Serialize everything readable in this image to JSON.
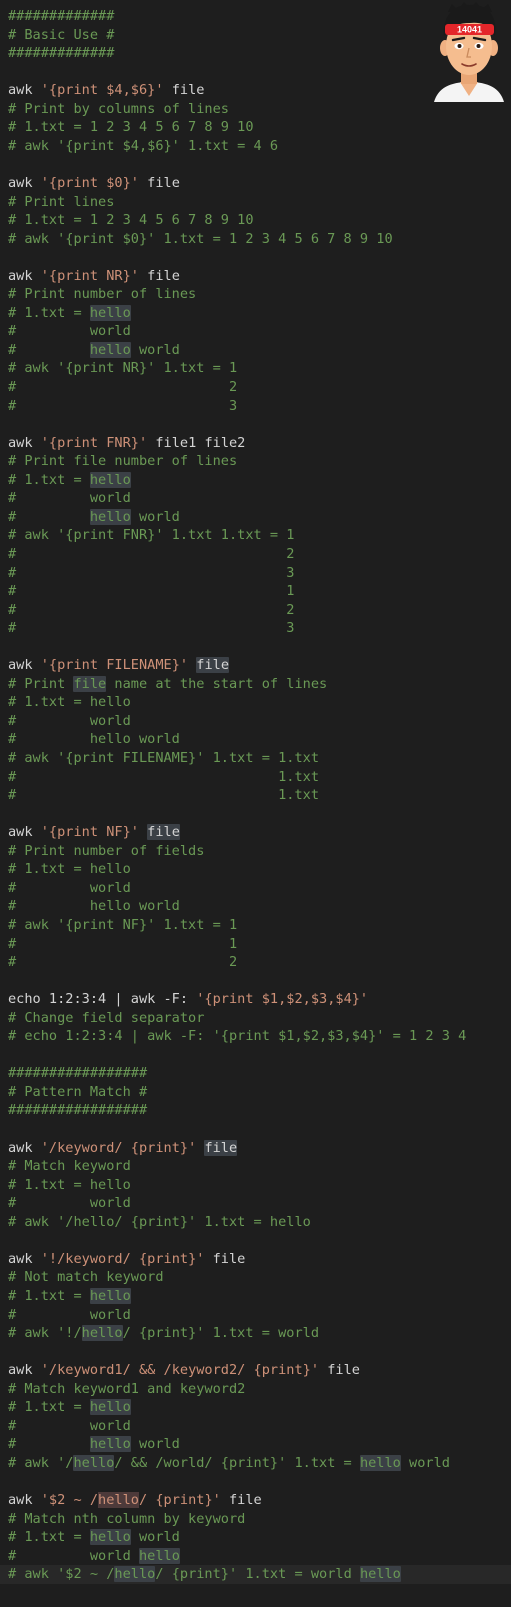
{
  "lines": [
    [
      [
        "#############",
        "cm"
      ]
    ],
    [
      [
        "# Basic Use #",
        "cm"
      ]
    ],
    [
      [
        "#############",
        "cm"
      ]
    ],
    [],
    [
      [
        "awk ",
        "pl"
      ],
      [
        "'{print $4,$6}'",
        "st"
      ],
      [
        " file",
        "pl"
      ]
    ],
    [
      [
        "# Print by columns of lines",
        "cm"
      ]
    ],
    [
      [
        "# 1.txt = 1 2 3 4 5 6 7 8 9 10",
        "cm"
      ]
    ],
    [
      [
        "# awk '{print $4,$6}' 1.txt = 4 6",
        "cm"
      ]
    ],
    [],
    [
      [
        "awk ",
        "pl"
      ],
      [
        "'{print $0}'",
        "st"
      ],
      [
        " file",
        "pl"
      ]
    ],
    [
      [
        "# Print lines",
        "cm"
      ]
    ],
    [
      [
        "# 1.txt = 1 2 3 4 5 6 7 8 9 10",
        "cm"
      ]
    ],
    [
      [
        "# awk '{print $0}' 1.txt = 1 2 3 4 5 6 7 8 9 10",
        "cm"
      ]
    ],
    [],
    [
      [
        "awk ",
        "pl"
      ],
      [
        "'{print NR}'",
        "st"
      ],
      [
        " file",
        "pl"
      ]
    ],
    [
      [
        "# Print number of lines",
        "cm"
      ]
    ],
    [
      [
        "# 1.txt = ",
        "cm"
      ],
      [
        "hello",
        "cm hl"
      ]
    ],
    [
      [
        "#         world",
        "cm"
      ]
    ],
    [
      [
        "#         ",
        "cm"
      ],
      [
        "hello",
        "cm hl"
      ],
      [
        " world",
        "cm"
      ]
    ],
    [
      [
        "# awk '{print NR}' 1.txt = 1",
        "cm"
      ]
    ],
    [
      [
        "#                          2",
        "cm"
      ]
    ],
    [
      [
        "#                          3",
        "cm"
      ]
    ],
    [],
    [
      [
        "awk ",
        "pl"
      ],
      [
        "'{print FNR}'",
        "st"
      ],
      [
        " file1 file2",
        "pl"
      ]
    ],
    [
      [
        "# Print file number of lines",
        "cm"
      ]
    ],
    [
      [
        "# 1.txt = ",
        "cm"
      ],
      [
        "hello",
        "cm hl"
      ]
    ],
    [
      [
        "#         world",
        "cm"
      ]
    ],
    [
      [
        "#         ",
        "cm"
      ],
      [
        "hello",
        "cm hl"
      ],
      [
        " world",
        "cm"
      ]
    ],
    [
      [
        "# awk '{print FNR}' 1.txt 1.txt = 1",
        "cm"
      ]
    ],
    [
      [
        "#                                 2",
        "cm"
      ]
    ],
    [
      [
        "#                                 3",
        "cm"
      ]
    ],
    [
      [
        "#                                 1",
        "cm"
      ]
    ],
    [
      [
        "#                                 2",
        "cm"
      ]
    ],
    [
      [
        "#                                 3",
        "cm"
      ]
    ],
    [],
    [
      [
        "awk ",
        "pl"
      ],
      [
        "'{print FILENAME}'",
        "st"
      ],
      [
        " ",
        "pl"
      ],
      [
        "file",
        "pl hl"
      ]
    ],
    [
      [
        "# Print ",
        "cm"
      ],
      [
        "file",
        "cm hl"
      ],
      [
        " name at the start of lines",
        "cm"
      ]
    ],
    [
      [
        "# 1.txt = hello",
        "cm"
      ]
    ],
    [
      [
        "#         world",
        "cm"
      ]
    ],
    [
      [
        "#         hello world",
        "cm"
      ]
    ],
    [
      [
        "# awk '{print FILENAME}' 1.txt = 1.txt",
        "cm"
      ]
    ],
    [
      [
        "#                                1.txt",
        "cm"
      ]
    ],
    [
      [
        "#                                1.txt",
        "cm"
      ]
    ],
    [],
    [
      [
        "awk ",
        "pl"
      ],
      [
        "'{print NF}'",
        "st"
      ],
      [
        " ",
        "pl"
      ],
      [
        "file",
        "pl hl"
      ]
    ],
    [
      [
        "# Print number of fields",
        "cm"
      ]
    ],
    [
      [
        "# 1.txt = hello",
        "cm"
      ]
    ],
    [
      [
        "#         world",
        "cm"
      ]
    ],
    [
      [
        "#         hello world",
        "cm"
      ]
    ],
    [
      [
        "# awk '{print NF}' 1.txt = 1",
        "cm"
      ]
    ],
    [
      [
        "#                          1",
        "cm"
      ]
    ],
    [
      [
        "#                          2",
        "cm"
      ]
    ],
    [],
    [
      [
        "echo 1:2:3:4 | awk -F: ",
        "pl"
      ],
      [
        "'{print $1,$2,$3,$4}'",
        "st"
      ]
    ],
    [
      [
        "# Change field separator",
        "cm"
      ]
    ],
    [
      [
        "# echo 1:2:3:4 | awk -F: '{print $1,$2,$3,$4}' = 1 2 3 4",
        "cm"
      ]
    ],
    [],
    [
      [
        "#################",
        "cm"
      ]
    ],
    [
      [
        "# Pattern Match #",
        "cm"
      ]
    ],
    [
      [
        "#################",
        "cm"
      ]
    ],
    [],
    [
      [
        "awk ",
        "pl"
      ],
      [
        "'/keyword/ {print}'",
        "st"
      ],
      [
        " ",
        "pl"
      ],
      [
        "file",
        "pl hl"
      ]
    ],
    [
      [
        "# Match keyword",
        "cm"
      ]
    ],
    [
      [
        "# 1.txt = hello",
        "cm"
      ]
    ],
    [
      [
        "#         world",
        "cm"
      ]
    ],
    [
      [
        "# awk '/hello/ {print}' 1.txt = hello",
        "cm"
      ]
    ],
    [],
    [
      [
        "awk ",
        "pl"
      ],
      [
        "'!/keyword/ {print}'",
        "st"
      ],
      [
        " file",
        "pl"
      ]
    ],
    [
      [
        "# Not match keyword",
        "cm"
      ]
    ],
    [
      [
        "# 1.txt = ",
        "cm"
      ],
      [
        "hello",
        "cm hl"
      ]
    ],
    [
      [
        "#         world",
        "cm"
      ]
    ],
    [
      [
        "# awk '!/",
        "cm"
      ],
      [
        "hello",
        "cm hl"
      ],
      [
        "/ {print}' 1.txt = world",
        "cm"
      ]
    ],
    [],
    [
      [
        "awk ",
        "pl"
      ],
      [
        "'/keyword1/ && /keyword2/ {print}'",
        "st"
      ],
      [
        " file",
        "pl"
      ]
    ],
    [
      [
        "# Match keyword1 and keyword2",
        "cm"
      ]
    ],
    [
      [
        "# 1.txt = ",
        "cm"
      ],
      [
        "hello",
        "cm hl"
      ]
    ],
    [
      [
        "#         world",
        "cm"
      ]
    ],
    [
      [
        "#         ",
        "cm"
      ],
      [
        "hello",
        "cm hl"
      ],
      [
        " world",
        "cm"
      ]
    ],
    [
      [
        "# awk '/",
        "cm"
      ],
      [
        "hello",
        "cm hl"
      ],
      [
        "/ && /world/ {print}' 1.txt = ",
        "cm"
      ],
      [
        "hello",
        "cm hl"
      ],
      [
        " world",
        "cm"
      ]
    ],
    [],
    [
      [
        "awk ",
        "pl"
      ],
      [
        "'$2 ~ /",
        "st"
      ],
      [
        "hello",
        "st hl2"
      ],
      [
        "/ {print}'",
        "st"
      ],
      [
        " file",
        "pl"
      ]
    ],
    [
      [
        "# Match nth column by keyword",
        "cm"
      ]
    ],
    [
      [
        "# 1.txt = ",
        "cm"
      ],
      [
        "hello",
        "cm hl"
      ],
      [
        " world",
        "cm"
      ]
    ],
    [
      [
        "#         world ",
        "cm"
      ],
      [
        "hello",
        "cm hl"
      ]
    ],
    [
      [
        "# awk '$2 ~ /",
        "cm"
      ],
      [
        "hello",
        "cm hl"
      ],
      [
        "/ {print}' 1.txt = world ",
        "cm"
      ],
      [
        "hello",
        "cm hl"
      ]
    ]
  ],
  "avatar": {
    "badge_text": "14041"
  }
}
